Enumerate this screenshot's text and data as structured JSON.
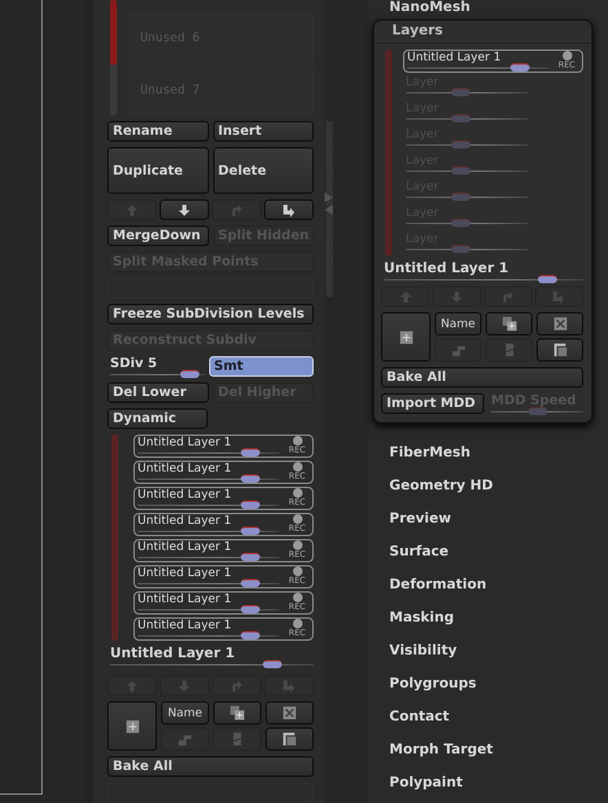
{
  "subtools": {
    "items": [
      {
        "label": "Unused 6"
      },
      {
        "label": "Unused 7"
      }
    ]
  },
  "left_rows": [
    {
      "kind": "buttons",
      "buttons": [
        {
          "label": "Rename",
          "disabled": false
        },
        {
          "label": "Insert",
          "disabled": false
        }
      ]
    },
    {
      "kind": "tall_buttons",
      "buttons": [
        {
          "label": "Duplicate",
          "disabled": false
        },
        {
          "label": "Delete",
          "disabled": false
        }
      ]
    },
    {
      "kind": "arrows",
      "arrows": [
        {
          "kind": "up",
          "disabled": true
        },
        {
          "kind": "down",
          "disabled": false
        },
        {
          "kind": "redo",
          "disabled": true
        },
        {
          "kind": "bend",
          "disabled": false
        }
      ]
    },
    {
      "kind": "buttons",
      "buttons": [
        {
          "label": "MergeDown",
          "disabled": false
        },
        {
          "label": "Split Hidden",
          "disabled": true
        }
      ]
    },
    {
      "kind": "buttons",
      "buttons": [
        {
          "label": "Split Masked Points",
          "disabled": true
        }
      ]
    },
    {
      "kind": "blank"
    },
    {
      "kind": "buttons",
      "buttons": [
        {
          "label": "Freeze SubDivision Levels",
          "disabled": false
        }
      ]
    },
    {
      "kind": "buttons",
      "buttons": [
        {
          "label": "Reconstruct Subdiv",
          "disabled": true
        }
      ]
    },
    {
      "kind": "slider_toggle",
      "slider": {
        "label": "SDiv 5",
        "level": 0.85
      },
      "toggle": {
        "label": "Smt",
        "selected": true
      }
    },
    {
      "kind": "buttons",
      "buttons": [
        {
          "label": "Del Lower",
          "disabled": false
        },
        {
          "label": "Del Higher",
          "disabled": true
        }
      ]
    },
    {
      "kind": "half_button",
      "buttons": [
        {
          "label": "Dynamic",
          "disabled": false
        }
      ]
    },
    {
      "kind": "layers",
      "layers": [
        {
          "kind": "active",
          "name": "Untitled Layer 1",
          "rec": "REC",
          "level": 0.8
        },
        {
          "kind": "active",
          "name": "Untitled Layer 1",
          "rec": "REC",
          "level": 0.8
        },
        {
          "kind": "active",
          "name": "Untitled Layer 1",
          "rec": "REC",
          "level": 0.8
        },
        {
          "kind": "active",
          "name": "Untitled Layer 1",
          "rec": "REC",
          "level": 0.8
        },
        {
          "kind": "active",
          "name": "Untitled Layer 1",
          "rec": "REC",
          "level": 0.8
        },
        {
          "kind": "active",
          "name": "Untitled Layer 1",
          "rec": "REC",
          "level": 0.8
        },
        {
          "kind": "active",
          "name": "Untitled Layer 1",
          "rec": "REC",
          "level": 0.8
        },
        {
          "kind": "active",
          "name": "Untitled Layer 1",
          "rec": "REC",
          "level": 0.8
        }
      ]
    },
    {
      "kind": "layer_slider",
      "label": "Untitled Layer 1",
      "level": 0.8
    },
    {
      "kind": "arrows",
      "arrows": [
        {
          "kind": "up",
          "disabled": true
        },
        {
          "kind": "down",
          "disabled": true
        },
        {
          "kind": "redo",
          "disabled": true
        },
        {
          "kind": "bend",
          "disabled": true
        }
      ]
    },
    {
      "kind": "layer_tools",
      "tools": [
        {
          "kind": "new",
          "disabled": false
        },
        {
          "kind": "name",
          "label": "Name",
          "disabled": false
        },
        {
          "kind": "copy",
          "disabled": false
        },
        {
          "kind": "delete",
          "disabled": false
        },
        {
          "kind": "step",
          "disabled": true
        },
        {
          "kind": "split",
          "disabled": true
        },
        {
          "kind": "corner",
          "disabled": false
        }
      ]
    },
    {
      "kind": "buttons",
      "buttons": [
        {
          "label": "Bake All",
          "disabled": false
        }
      ]
    },
    {
      "kind": "blank"
    }
  ],
  "top_label": "NanoMesh",
  "palette": {
    "title": "Layers",
    "rows": [
      {
        "kind": "layers",
        "layers": [
          {
            "kind": "active",
            "name": "Untitled Layer 1",
            "rec": "REC",
            "level": 0.8
          },
          {
            "kind": "empty",
            "name": "Layer",
            "level": 0.45
          },
          {
            "kind": "empty",
            "name": "Layer",
            "level": 0.45
          },
          {
            "kind": "empty",
            "name": "Layer",
            "level": 0.45
          },
          {
            "kind": "empty",
            "name": "Layer",
            "level": 0.45
          },
          {
            "kind": "empty",
            "name": "Layer",
            "level": 0.45
          },
          {
            "kind": "empty",
            "name": "Layer",
            "level": 0.45
          },
          {
            "kind": "empty",
            "name": "Layer",
            "level": 0.45
          }
        ]
      },
      {
        "kind": "layer_slider",
        "label": "Untitled Layer 1",
        "level": 0.82
      },
      {
        "kind": "arrows",
        "arrows": [
          {
            "kind": "up",
            "disabled": true
          },
          {
            "kind": "down",
            "disabled": true
          },
          {
            "kind": "redo",
            "disabled": true
          },
          {
            "kind": "bend",
            "disabled": true
          }
        ]
      },
      {
        "kind": "layer_tools",
        "tools": [
          {
            "kind": "new",
            "disabled": false
          },
          {
            "kind": "name",
            "label": "Name",
            "disabled": false
          },
          {
            "kind": "copy",
            "disabled": false
          },
          {
            "kind": "delete",
            "disabled": false
          },
          {
            "kind": "step",
            "disabled": true
          },
          {
            "kind": "split",
            "disabled": true
          },
          {
            "kind": "corner",
            "disabled": false
          }
        ]
      },
      {
        "kind": "buttons",
        "buttons": [
          {
            "label": "Bake All",
            "disabled": false
          }
        ]
      },
      {
        "kind": "button_slider",
        "button": {
          "label": "Import MDD",
          "disabled": false
        },
        "slider": {
          "label": "MDD Speed",
          "level": 0.5,
          "disabled": true
        }
      }
    ]
  },
  "menu": [
    {
      "label": "FiberMesh"
    },
    {
      "label": "Geometry HD"
    },
    {
      "label": "Preview"
    },
    {
      "label": "Surface"
    },
    {
      "label": "Deformation"
    },
    {
      "label": "Masking"
    },
    {
      "label": "Visibility"
    },
    {
      "label": "Polygroups"
    },
    {
      "label": "Contact"
    },
    {
      "label": "Morph Target"
    },
    {
      "label": "Polypaint"
    }
  ]
}
